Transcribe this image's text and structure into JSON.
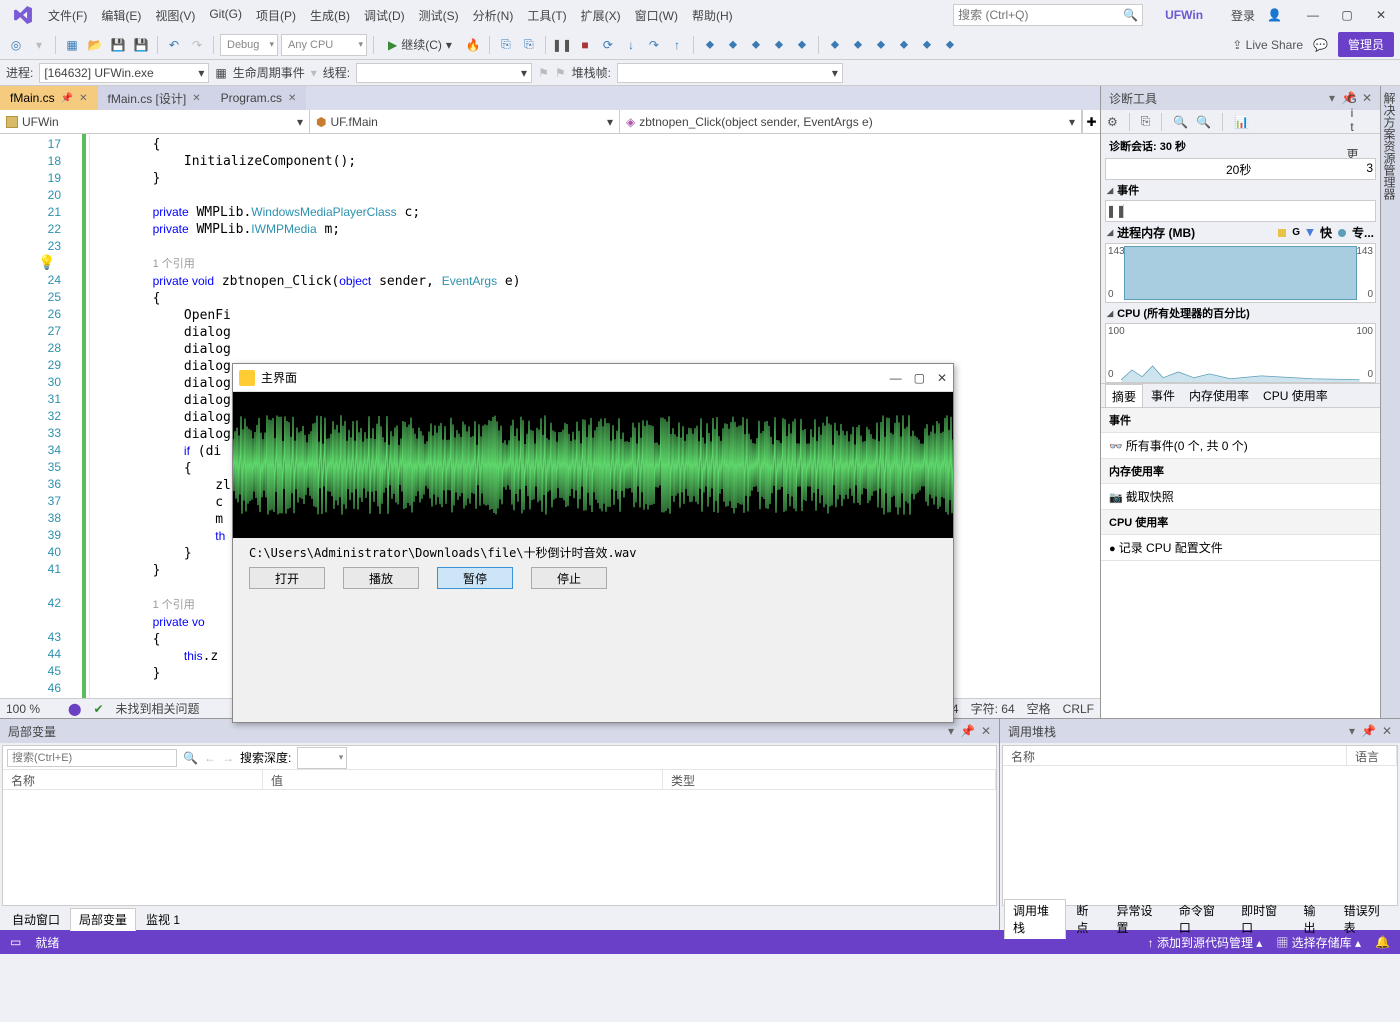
{
  "title_menu": [
    "文件(F)",
    "编辑(E)",
    "视图(V)",
    "Git(G)",
    "项目(P)",
    "生成(B)",
    "调试(D)",
    "测试(S)",
    "分析(N)",
    "工具(T)",
    "扩展(X)",
    "窗口(W)",
    "帮助(H)"
  ],
  "search_placeholder": "搜索 (Ctrl+Q)",
  "app_name": "UFWin",
  "login": "登录",
  "admin": "管理员",
  "live_share": "Live Share",
  "config": "Debug",
  "platform": "Any CPU",
  "continue": "继续(C)",
  "process_label": "进程:",
  "process": "[164632] UFWin.exe",
  "lifecycle": "生命周期事件",
  "thread_label": "线程:",
  "stackframe_label": "堆栈帧:",
  "tabs": [
    {
      "label": "fMain.cs",
      "active": true,
      "pin": true
    },
    {
      "label": "fMain.cs [设计]"
    },
    {
      "label": "Program.cs"
    }
  ],
  "nav": [
    "UFWin",
    "UF.fMain",
    "zbtnopen_Click(object sender, EventArgs e)"
  ],
  "line_start": 17,
  "ref_text": "1 个引用",
  "status": {
    "zoom": "100 %",
    "issues": "未找到相关问题",
    "line": "行: 24",
    "col": "字符: 64",
    "ins": "空格",
    "eol": "CRLF"
  },
  "diag": {
    "title": "诊断工具",
    "session": "诊断会话: 30 秒",
    "t20": "20秒",
    "events": "事件",
    "mem": "进程内存 (MB)",
    "mem_v": "143",
    "mem_0": "0",
    "legend": [
      "GC",
      "快",
      "专..."
    ],
    "cpu": "CPU (所有处理器的百分比)",
    "cpu_hi": "100",
    "cpu_lo": "0",
    "tabs": [
      "摘要",
      "事件",
      "内存使用率",
      "CPU 使用率"
    ],
    "sec_events": "事件",
    "evt_line": "所有事件(0 个, 共 0 个)",
    "sec_mem": "内存使用率",
    "mem_line": "截取快照",
    "sec_cpu": "CPU 使用率",
    "cpu_line": "记录 CPU 配置文件"
  },
  "vtabs": [
    "解决方案资源管理器",
    "Git 更改"
  ],
  "locals": {
    "title": "局部变量",
    "search": "搜索(Ctrl+E)",
    "depth": "搜索深度:",
    "cols": [
      "名称",
      "值",
      "类型"
    ],
    "tabs": [
      "自动窗口",
      "局部变量",
      "监视 1"
    ]
  },
  "callstack": {
    "title": "调用堆栈",
    "cols": [
      "名称",
      "语言"
    ],
    "tabs": [
      "调用堆栈",
      "断点",
      "异常设置",
      "命令窗口",
      "即时窗口",
      "输出",
      "错误列表"
    ]
  },
  "statusbar": {
    "ready": "就绪",
    "add_src": "添加到源代码管理",
    "select_repo": "选择存储库"
  },
  "app_win": {
    "title": "主界面",
    "path": "C:\\Users\\Administrator\\Downloads\\file\\十秒倒计时音效.wav",
    "btns": [
      "打开",
      "播放",
      "暂停",
      "停止"
    ]
  },
  "chart_data": [
    {
      "type": "area",
      "title": "进程内存 (MB)",
      "ylabel": "MB",
      "ylim": [
        0,
        143
      ],
      "x": [
        0,
        30
      ],
      "values": [
        143,
        143
      ]
    },
    {
      "type": "line",
      "title": "CPU (所有处理器的百分比)",
      "ylabel": "%",
      "ylim": [
        0,
        100
      ],
      "x": [
        0,
        3,
        5,
        7,
        9,
        12,
        15,
        18,
        22,
        26,
        30
      ],
      "values": [
        0,
        18,
        8,
        22,
        6,
        14,
        5,
        9,
        4,
        6,
        3
      ]
    }
  ]
}
